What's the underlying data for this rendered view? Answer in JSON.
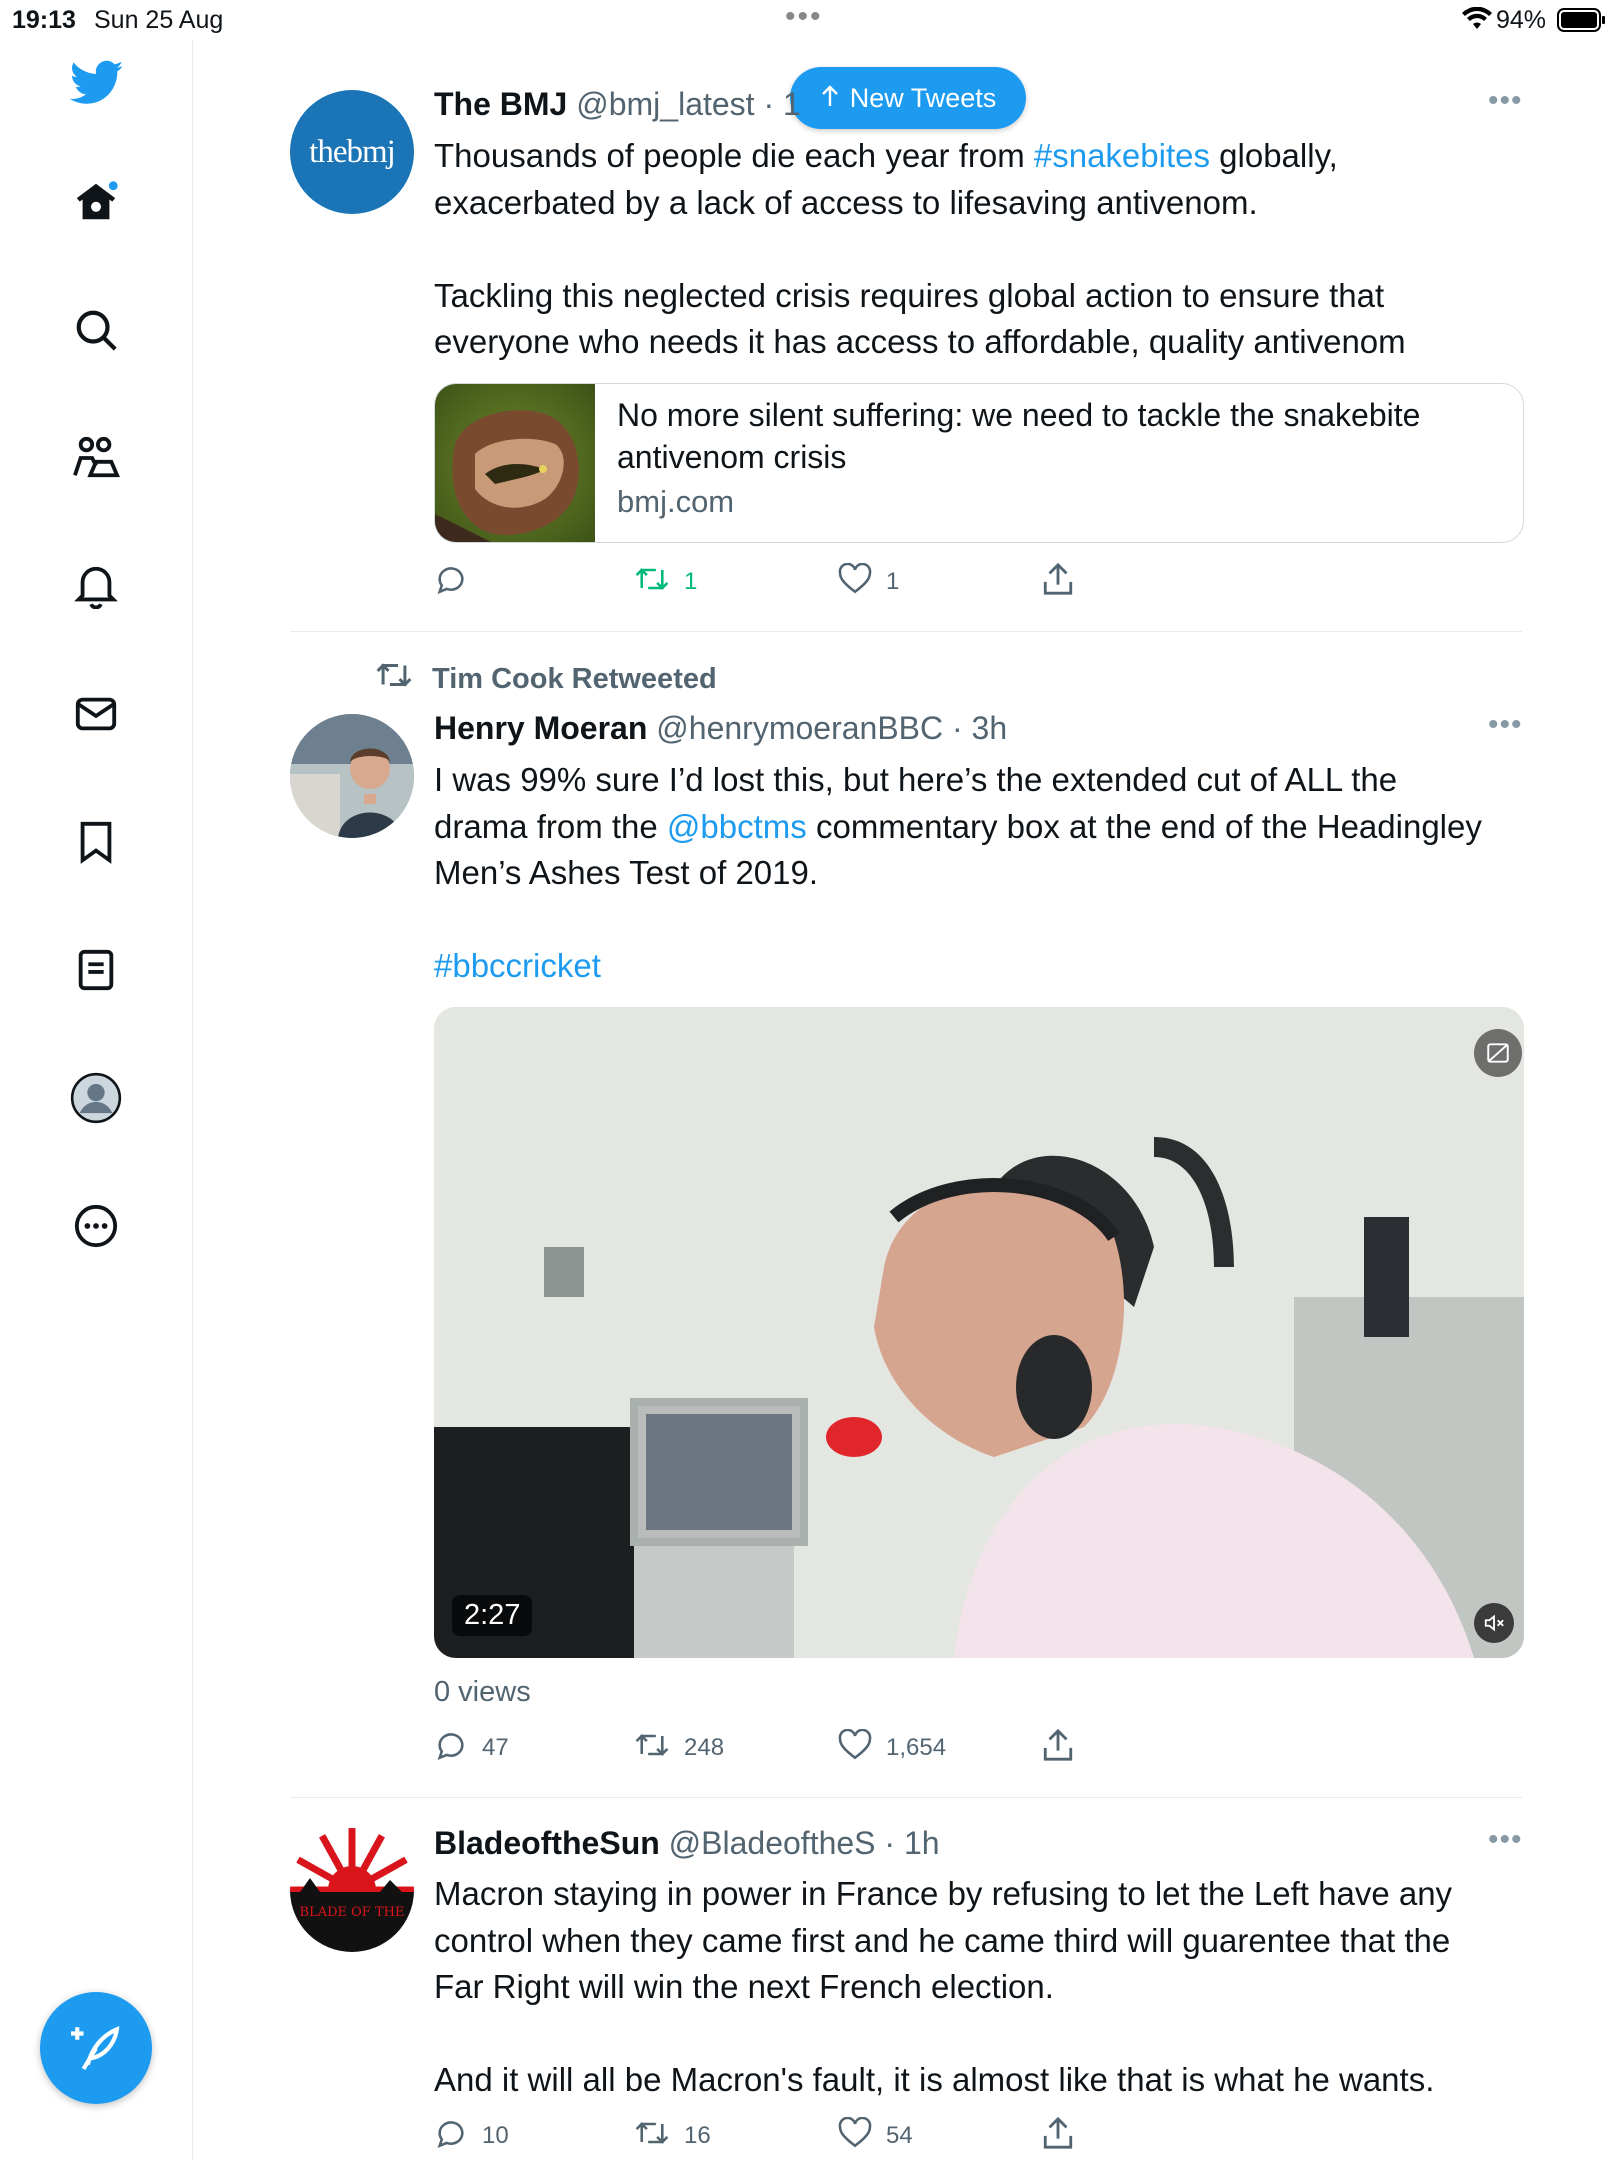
{
  "status_bar": {
    "time": "19:13",
    "date": "Sun 25 Aug",
    "battery": "94%"
  },
  "sidebar": {
    "items": [
      "home-icon",
      "search-icon",
      "communities-icon",
      "notifications-icon",
      "messages-icon",
      "bookmarks-icon",
      "lists-icon",
      "profile-icon",
      "more-icon"
    ],
    "compose": "compose-icon"
  },
  "new_tweets_label": "New Tweets",
  "tweets": [
    {
      "name": "The BMJ",
      "handle": "@bmj_latest · 1",
      "avatar_text": "thebmj",
      "text_1a": "Thousands of people die each year from ",
      "text_1b": "#snakebites",
      "text_1c": " globally,",
      "text_2": "exacerbated by a lack of access to lifesaving antivenom.",
      "text_3": "Tackling this neglected crisis requires global action to ensure that",
      "text_4": "everyone who needs it has access to affordable, quality antivenom",
      "card": {
        "title": "No more silent suffering: we need to tackle the snakebite antivenom crisis",
        "domain": "bmj.com"
      },
      "replies": "",
      "retweets": "1",
      "likes": "1"
    },
    {
      "retweeted_by": "Tim Cook Retweeted",
      "name": "Henry Moeran",
      "handle": "@henrymoeranBBC · 3h",
      "text_1": "I was 99% sure I’d lost this, but here’s the extended cut of ALL the",
      "text_2a": "drama from the ",
      "text_2b": "@bbctms",
      "text_2c": " commentary box at the end of the Headingley",
      "text_3": "Men’s Ashes Test of 2019.",
      "hashtag": "#bbccricket",
      "video_duration": "2:27",
      "views": "0 views",
      "replies": "47",
      "retweets": "248",
      "likes": "1,654"
    },
    {
      "name": "BladeoftheSun",
      "handle": "@BladeoftheS · 1h",
      "avatar_text": "BLADE OF THE",
      "text_1": "Macron staying in power in France by refusing to let the Left have any",
      "text_2": "control when they came first and he came third will guarentee that the",
      "text_3": "Far Right will win the next French election.",
      "text_4": "And it will all be Macron's fault, it is almost like that is what he wants.",
      "replies": "10",
      "retweets": "16",
      "likes": "54"
    }
  ],
  "colors": {
    "accent": "#1d9bf0",
    "retweet_green": "#00ba7c",
    "muted": "#536471"
  }
}
